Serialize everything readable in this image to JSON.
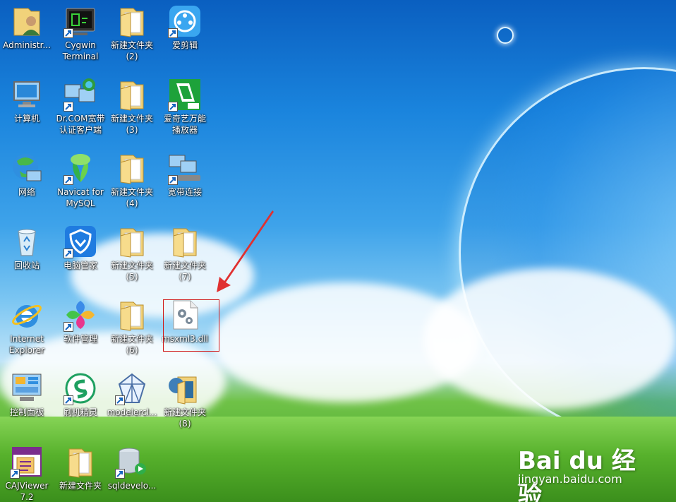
{
  "desktop": {
    "icons": [
      {
        "label": "Administr...",
        "type": "user"
      },
      {
        "label": "Cygwin\nTerminal",
        "type": "terminal"
      },
      {
        "label": "新建文件夹\n(2)",
        "type": "folder"
      },
      {
        "label": "爱剪辑",
        "type": "video"
      },
      {
        "label": "计算机",
        "type": "computer"
      },
      {
        "label": "Dr.COM宽带\n认证客户端",
        "type": "network-pc"
      },
      {
        "label": "新建文件夹\n(3)",
        "type": "folder"
      },
      {
        "label": "爱奇艺万能\n播放器",
        "type": "player"
      },
      {
        "label": "网络",
        "type": "network"
      },
      {
        "label": "Navicat for\nMySQL",
        "type": "navicat"
      },
      {
        "label": "新建文件夹\n(4)",
        "type": "folder"
      },
      {
        "label": "宽带连接",
        "type": "broadband"
      },
      {
        "label": "回收站",
        "type": "recycle-bin"
      },
      {
        "label": "电脑管家",
        "type": "shield"
      },
      {
        "label": "新建文件夹\n(5)",
        "type": "folder"
      },
      {
        "label": "新建文件夹\n(7)",
        "type": "folder"
      },
      {
        "label": "Internet\nExplorer",
        "type": "ie"
      },
      {
        "label": "软件管理",
        "type": "software"
      },
      {
        "label": "新建文件夹\n(6)",
        "type": "folder"
      },
      {
        "label": "msxml3.dll",
        "type": "dll"
      },
      {
        "label": "控制面板",
        "type": "control-panel"
      },
      {
        "label": "刷机精灵",
        "type": "flash"
      },
      {
        "label": "modelercl...",
        "type": "modeler"
      },
      {
        "label": "新建文件夹\n(8)",
        "type": "folder-tree"
      },
      {
        "label": "CAJViewer\n7.2",
        "type": "caj"
      },
      {
        "label": "新建文件夹",
        "type": "folder"
      },
      {
        "label": "sqldevelo...",
        "type": "database"
      }
    ]
  },
  "watermark": {
    "logo": "Bai du 经验",
    "url": "jingyan.baidu.com"
  },
  "colors": {
    "selection_box": "#d01818",
    "arrow": "#e03030",
    "sky": "#1a84dd",
    "grass": "#57b12c"
  }
}
